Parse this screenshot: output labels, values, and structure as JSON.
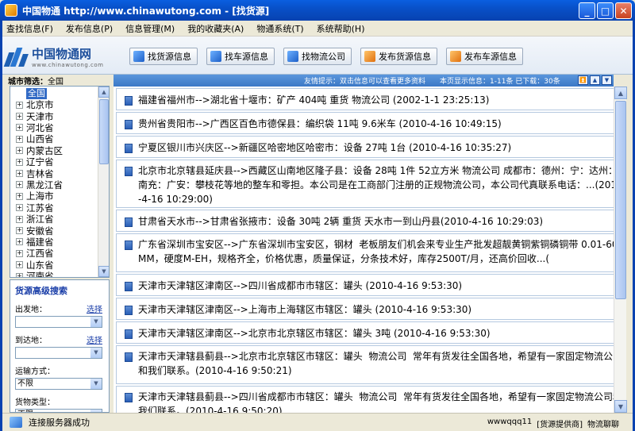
{
  "window": {
    "title": "中国物通 http://www.chinawutong.com - [找货源]",
    "min": "_",
    "max": "□",
    "close": "✕"
  },
  "menu": [
    "查找信息(F)",
    "发布信息(P)",
    "信息管理(M)",
    "我的收藏夹(A)",
    "物通系统(T)",
    "系统帮助(H)"
  ],
  "logo": {
    "name": "中国物通网",
    "url": "www.chinawutong.com"
  },
  "toolbar": [
    {
      "label": "找货源信息",
      "icon": "search-cargo-icon"
    },
    {
      "label": "找车源信息",
      "icon": "search-truck-icon"
    },
    {
      "label": "找物流公司",
      "icon": "search-company-icon"
    },
    {
      "label": "发布货源信息",
      "icon": "publish-cargo-icon"
    },
    {
      "label": "发布车源信息",
      "icon": "publish-truck-icon"
    }
  ],
  "sidebar": {
    "filter_label": "城市筛选：",
    "filter_value": "全国",
    "tree_root": "全国",
    "provinces": [
      "北京市",
      "天津市",
      "河北省",
      "山西省",
      "内蒙古区",
      "辽宁省",
      "吉林省",
      "黑龙江省",
      "上海市",
      "江苏省",
      "浙江省",
      "安徽省",
      "福建省",
      "江西省",
      "山东省",
      "河南省"
    ],
    "search": {
      "title": "货源高级搜索",
      "from_label": "出发地：",
      "to_label": "到达地：",
      "select_link": "选择",
      "transport_label": "运输方式：",
      "transport_value": "不限",
      "goods_label": "货物类型：",
      "goods_value": "不限"
    }
  },
  "infobar": {
    "hint": "友情提示：双击信息可以查看更多资料",
    "page_info": "本页显示信息：1-11条  已下载：30条"
  },
  "listings": [
    "福建省福州市-->湖北省十堰市：矿产 404吨 重货 物流公司 (2002-1-1 23:25:13)",
    "贵州省贵阳市-->广西区百色市德保县：编织袋 11吨 9.6米车 (2010-4-16 10:49:15)",
    "宁夏区银川市兴庆区-->新疆区哈密地区哈密市：设备 27吨 1台 (2010-4-16 10:35:27)",
    "北京市北京辖县延庆县-->西藏区山南地区隆子县：设备 28吨 1件 52立方米 物流公司 成都市：德州：宁：达州：南充：广安：攀枝花等地的整车和零担。本公司是在工商部门注册的正规物流公司，本公司代真联系电话：...(2010-4-16 10:29:00)",
    "甘肃省天水市-->甘肃省张掖市：设备 30吨 2辆 重货 天水市一到山丹县(2010-4-16 10:29:03)",
    "广东省深圳市宝安区-->广东省深圳市宝安区，钢材  老板朋友们机会来专业生产批发超靓黄铜紫铜磷铜带 0.01-60MM，硬度M-EH，规格齐全，价格优惠，质量保证，分条技术好，库存2500T/月，还高价回收...(",
    "天津市天津辖区津南区-->四川省成都市市辖区：罐头 (2010-4-16 9:53:30)",
    "天津市天津辖区津南区-->上海市上海辖区市辖区：罐头 (2010-4-16 9:53:30)",
    "天津市天津辖区津南区-->北京市北京辖区市辖区：罐头 3吨 (2010-4-16 9:53:30)",
    "天津市天津辖县蓟县-->北京市北京辖区市辖区：罐头  物流公司  常年有货发往全国各地，希望有一家固定物流公司和我们联系。(2010-4-16 9:50:21)",
    "天津市天津辖县蓟县-->四川省成都市市辖区：罐头  物流公司  常年有货发往全国各地，希望有一家固定物流公司和我们联系。(2010-4-16 9:50:20)"
  ],
  "status": {
    "message": "连接服务器成功",
    "user": "wwwqqq11",
    "provider": "[货源提供商]",
    "link": "物流聊聊"
  }
}
